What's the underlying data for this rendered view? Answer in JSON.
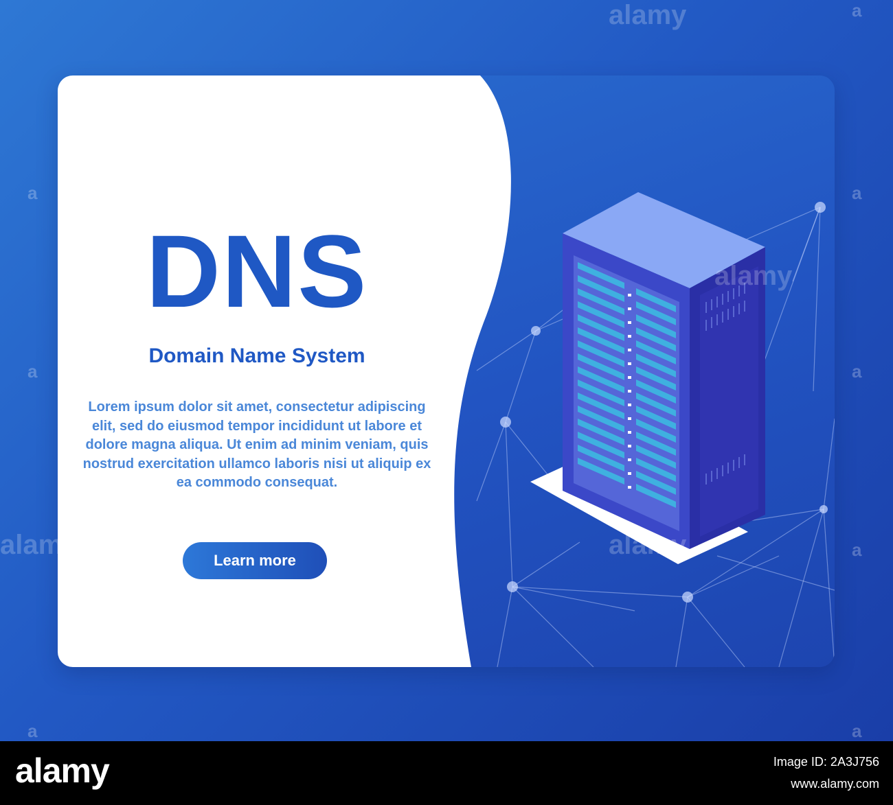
{
  "hero": {
    "title": "DNS",
    "subtitle": "Domain Name System",
    "body": "Lorem ipsum dolor sit amet, consectetur adipiscing elit, sed do eiusmod tempor incididunt ut labore et dolore magna aliqua. Ut enim ad minim veniam, quis nostrud exercitation ullamco laboris nisi ut aliquip ex ea commodo consequat.",
    "button_label": "Learn more"
  },
  "illustration": {
    "icon": "server-rack-icon",
    "network": "network-mesh"
  },
  "watermark": {
    "text": "alamy",
    "small": "a"
  },
  "footer": {
    "logo": "alamy",
    "image_id_line": "Image ID: 2A3J756",
    "url": "www.alamy.com"
  },
  "colors": {
    "background": "#2259c4",
    "accent": "#1f58c4",
    "panel": "#ffffff",
    "server_front": "#3b48c8",
    "server_top": "#8aa8f5",
    "slot": "#3fb0e0"
  }
}
